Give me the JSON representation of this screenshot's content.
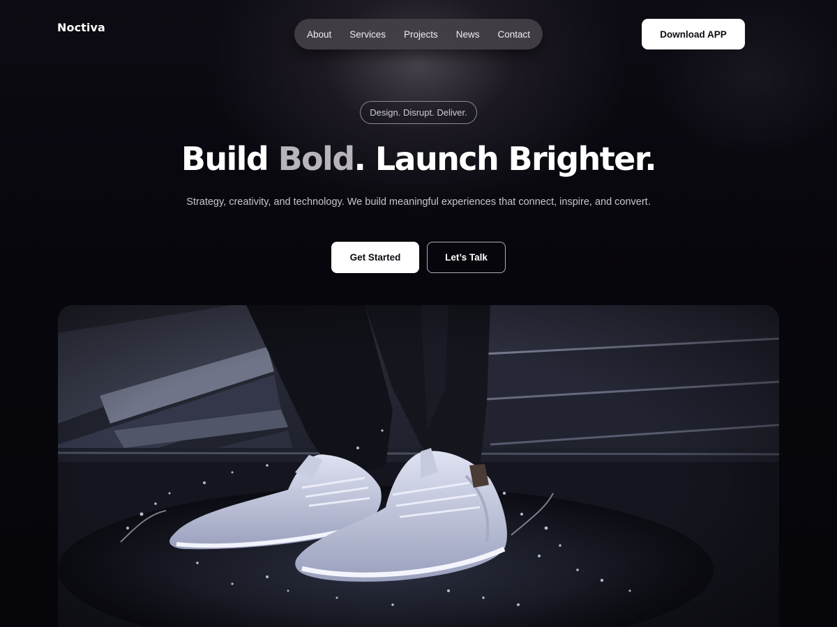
{
  "brand": {
    "name": "Noctiva"
  },
  "nav": {
    "items": [
      {
        "label": "About"
      },
      {
        "label": "Services"
      },
      {
        "label": "Projects"
      },
      {
        "label": "News"
      },
      {
        "label": "Contact"
      }
    ]
  },
  "header": {
    "download_label": "Download APP"
  },
  "hero": {
    "tagline": "Design. Disrupt. Deliver.",
    "headline_part1": "Build ",
    "headline_accent": "Bold",
    "headline_part2": ". Launch Brighter.",
    "subtitle": "Strategy, creativity, and technology. We build meaningful experiences that connect, inspire, and convert.",
    "primary_cta": "Get Started",
    "secondary_cta": "Let’s Talk"
  },
  "colors": {
    "background": "#07060c",
    "button_bg": "#ffffff",
    "nav_bg": "#444048",
    "headline_accent": "#b8b4bb"
  }
}
